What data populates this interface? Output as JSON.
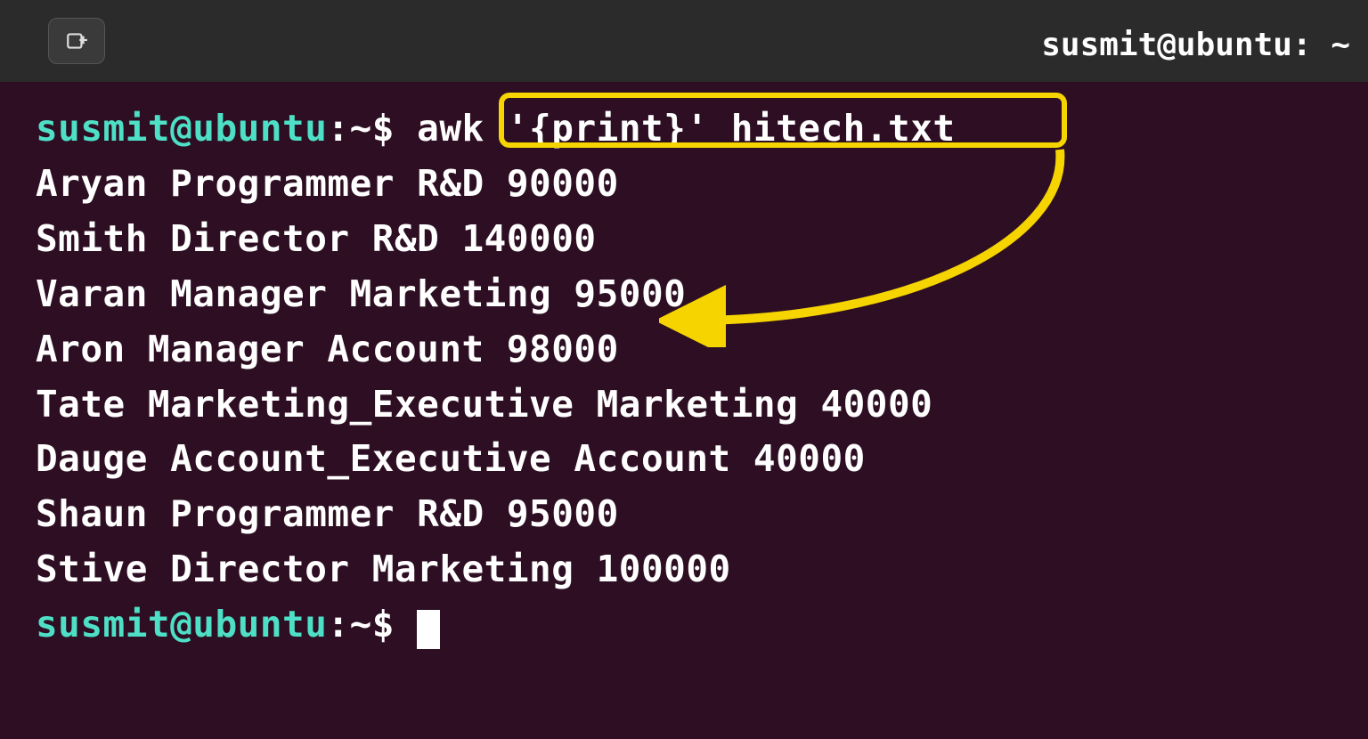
{
  "window": {
    "title": "susmit@ubuntu: ~"
  },
  "prompt": {
    "userhost": "susmit@ubuntu",
    "separator": ":",
    "path": "~",
    "symbol": "$"
  },
  "command": "awk '{print}' hitech.txt",
  "output": [
    "Aryan Programmer R&D 90000",
    "Smith Director R&D 140000",
    "Varan Manager Marketing 95000",
    "Aron Manager Account 98000",
    "Tate Marketing_Executive Marketing 40000",
    "Dauge Account_Executive Account 40000",
    "Shaun Programmer R&D 95000",
    "Stive Director Marketing 100000"
  ],
  "annotation": {
    "highlight_color": "#f5d400",
    "arrow_color": "#f5d400"
  }
}
